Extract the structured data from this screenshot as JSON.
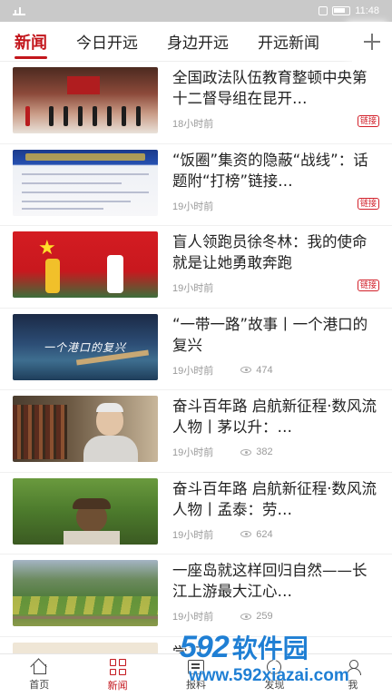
{
  "status_bar": {
    "time": "11:48"
  },
  "tabs": [
    "新闻",
    "今日开远",
    "身边开远",
    "开远新闻"
  ],
  "feed": [
    {
      "title": "全国政法队伍教育整顿中央第十二督导组在昆开…",
      "time": "18小时前",
      "views": "",
      "tag": "链接"
    },
    {
      "title": "“饭圈”集资的隐蔽“战线”：话题附“打榜”链接…",
      "time": "19小时前",
      "views": "",
      "tag": "链接"
    },
    {
      "title": "盲人领跑员徐冬林：我的使命就是让她勇敢奔跑",
      "time": "19小时前",
      "views": "",
      "tag": "链接"
    },
    {
      "title": "“一带一路”故事丨一个港口的复兴",
      "time": "19小时前",
      "views": "474",
      "tag": ""
    },
    {
      "title": "奋斗百年路 启航新征程·数风流人物丨茅以升：…",
      "time": "19小时前",
      "views": "382",
      "tag": ""
    },
    {
      "title": "奋斗百年路 启航新征程·数风流人物丨孟泰：劳…",
      "time": "19小时前",
      "views": "624",
      "tag": ""
    },
    {
      "title": "一座岛就这样回归自然——长江上游最大江心…",
      "time": "19小时前",
      "views": "259",
      "tag": ""
    },
    {
      "title": "学习…",
      "time": "",
      "views": "",
      "tag": ""
    }
  ],
  "thumb_captions": {
    "port": "一个港口的复兴"
  },
  "bottom_nav": [
    {
      "label": "首页",
      "icon": "home-icon"
    },
    {
      "label": "新闻",
      "icon": "grid-icon"
    },
    {
      "label": "报料",
      "icon": "report-icon"
    },
    {
      "label": "发现",
      "icon": "discover-icon"
    },
    {
      "label": "我",
      "icon": "user-icon"
    }
  ],
  "watermark": {
    "brand_num": "592",
    "brand_cn": "软件园",
    "url": "www.592xiazai.com"
  },
  "colors": {
    "accent": "#c3161c",
    "watermark": "#1f7fd4"
  }
}
